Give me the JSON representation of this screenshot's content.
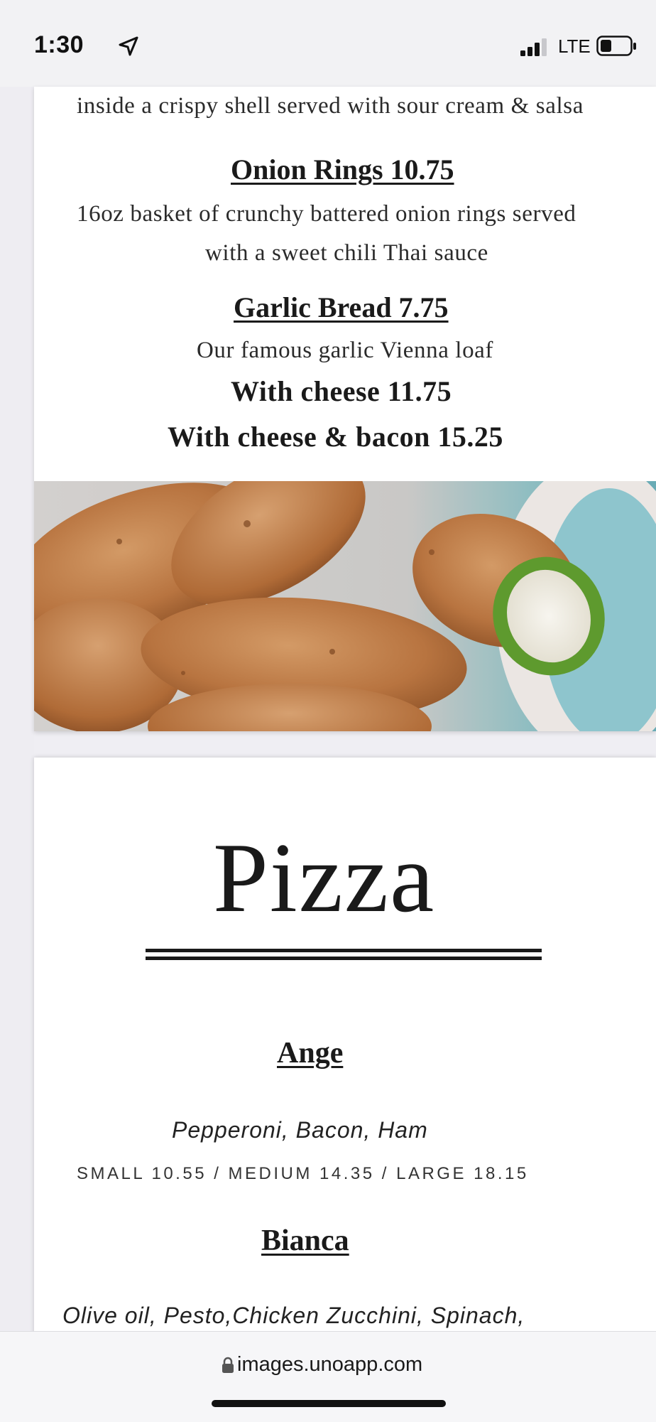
{
  "status_bar": {
    "time": "1:30",
    "network": "LTE",
    "icons": [
      "location-arrow-icon",
      "signal-bars-icon",
      "battery-icon"
    ]
  },
  "menu": {
    "partial_desc": "inside a crispy shell served with sour cream & salsa",
    "onion_rings": {
      "title": "Onion Rings  10.75",
      "desc_line1": "16oz basket of crunchy battered onion rings served",
      "desc_line2": "with a sweet chili Thai sauce"
    },
    "garlic_bread": {
      "title": "Garlic Bread  7.75",
      "desc": "Our famous garlic Vienna loaf",
      "with_cheese": "With cheese  11.75",
      "with_cheese_bacon": "With cheese & bacon  15.25"
    },
    "photo_subject": "jalapeno poppers"
  },
  "pizza": {
    "heading": "Pizza",
    "items": [
      {
        "name": "Ange",
        "ingredients": "Pepperoni, Bacon, Ham",
        "prices": "SMALL 10.55 / MEDIUM 14.35 / LARGE 18.15"
      },
      {
        "name": "Bianca",
        "ingredients": "Olive oil, Pesto,Chicken Zucchini, Spinach,"
      }
    ]
  },
  "address_bar": {
    "url": "images.unoapp.com"
  }
}
